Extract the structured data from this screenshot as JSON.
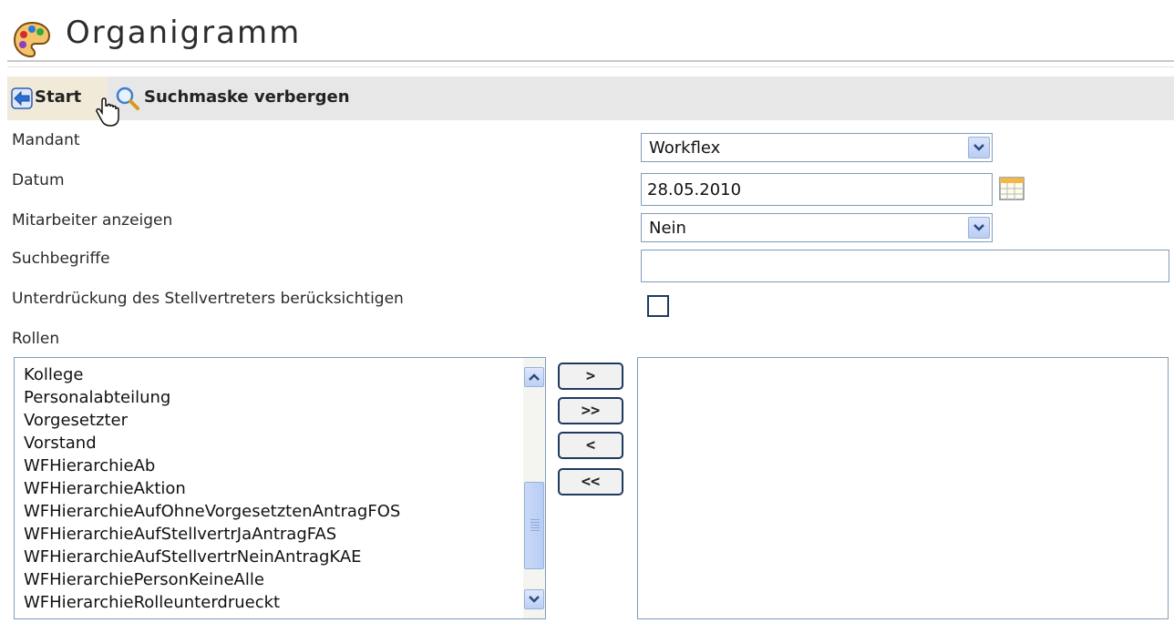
{
  "header": {
    "title": "Organigramm",
    "icon": "palette-icon"
  },
  "toolbar": {
    "start_label": "Start",
    "search_label": "Suchmaske verbergen"
  },
  "form": {
    "mandant": {
      "label": "Mandant",
      "value": "Workflex"
    },
    "datum": {
      "label": "Datum",
      "value": "28.05.2010"
    },
    "mitarbeiter": {
      "label": "Mitarbeiter anzeigen",
      "value": "Nein"
    },
    "suchbegriffe": {
      "label": "Suchbegriffe",
      "value": ""
    },
    "stellvertreter": {
      "label": "Unterdrückung des Stellvertreters berücksichtigen",
      "checked": false
    },
    "rollen": {
      "label": "Rollen",
      "available": [
        "Kollege",
        "Personalabteilung",
        "Vorgesetzter",
        "Vorstand",
        "WFHierarchieAb",
        "WFHierarchieAktion",
        "WFHierarchieAufOhneVorgesetztenAntragFOS",
        "WFHierarchieAufStellvertrJaAntragFAS",
        "WFHierarchieAufStellvertrNeinAntragKAE",
        "WFHierarchiePersonKeineAlle",
        "WFHierarchieRolleunterdrueckt"
      ],
      "selected": [],
      "buttons": {
        "add": ">",
        "add_all": ">>",
        "remove": "<",
        "remove_all": "<<"
      }
    }
  },
  "colors": {
    "toolbar_bg": "#e7e7e7",
    "start_highlight": "#f2ead8",
    "field_border": "#7f9db9",
    "control_blue": "#b9cdf3"
  }
}
